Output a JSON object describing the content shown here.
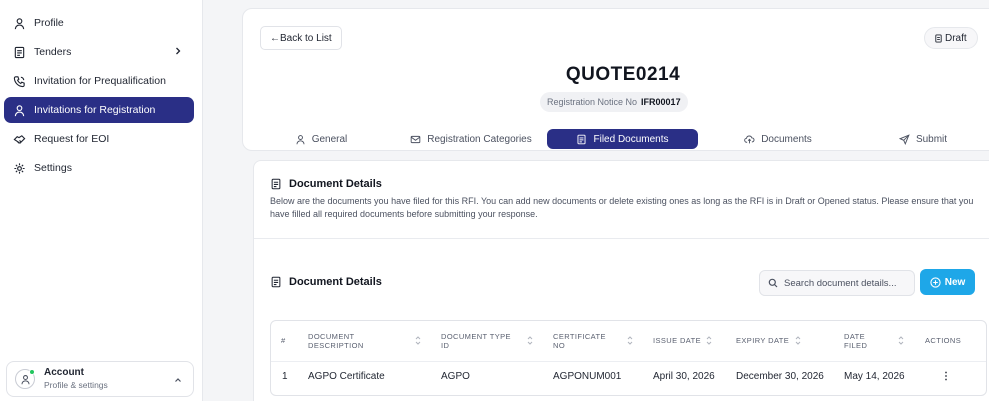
{
  "sidebar": {
    "items": [
      {
        "label": "Profile",
        "icon": "user-icon"
      },
      {
        "label": "Tenders",
        "icon": "document-icon"
      },
      {
        "label": "Invitation for Prequalification",
        "icon": "phone-icon"
      },
      {
        "label": "Invitations for Registration",
        "icon": "user-icon"
      },
      {
        "label": "Request for EOI",
        "icon": "handshake-icon"
      },
      {
        "label": "Settings",
        "icon": "gear-icon"
      }
    ],
    "active_index": 3,
    "account": {
      "name": "Account",
      "subtitle": "Profile & settings"
    }
  },
  "header": {
    "back_label": "←Back to List",
    "status_label": "Draft",
    "title": "QUOTE0214",
    "notice_label": "Registration Notice No",
    "notice_value": "IFR00017"
  },
  "tabs": [
    {
      "label": "General",
      "icon": "user-icon"
    },
    {
      "label": "Registration Categories",
      "icon": "mail-icon"
    },
    {
      "label": "Filed Documents",
      "icon": "file-icon",
      "active": true
    },
    {
      "label": "Documents",
      "icon": "cloud-upload-icon"
    },
    {
      "label": "Submit",
      "icon": "send-icon"
    }
  ],
  "details": {
    "title": "Document Details",
    "description": "Below are the documents you have filed for this RFI. You can add new documents or delete existing ones as long as the RFI is in Draft or Opened status. Please ensure that you have filled all required documents before submitting your response."
  },
  "documents": {
    "title": "Document Details",
    "search_placeholder": "Search document details...",
    "new_label": "New",
    "columns": [
      "#",
      "DOCUMENT DESCRIPTION",
      "DOCUMENT TYPE ID",
      "CERTIFICATE NO",
      "ISSUE DATE",
      "EXPIRY DATE",
      "DATE FILED",
      "ACTIONS"
    ],
    "rows": [
      {
        "index": "1",
        "description": "AGPO Certificate",
        "type_id": "AGPO",
        "certificate_no": "AGPONUM001",
        "issue_date": "April 30, 2026",
        "expiry_date": "December 30, 2026",
        "date_filed": "May 14, 2026",
        "actions": "⋮"
      }
    ]
  },
  "colors": {
    "primary": "#2a2f86",
    "accent": "#1ea7e8",
    "online": "#22c55e"
  }
}
